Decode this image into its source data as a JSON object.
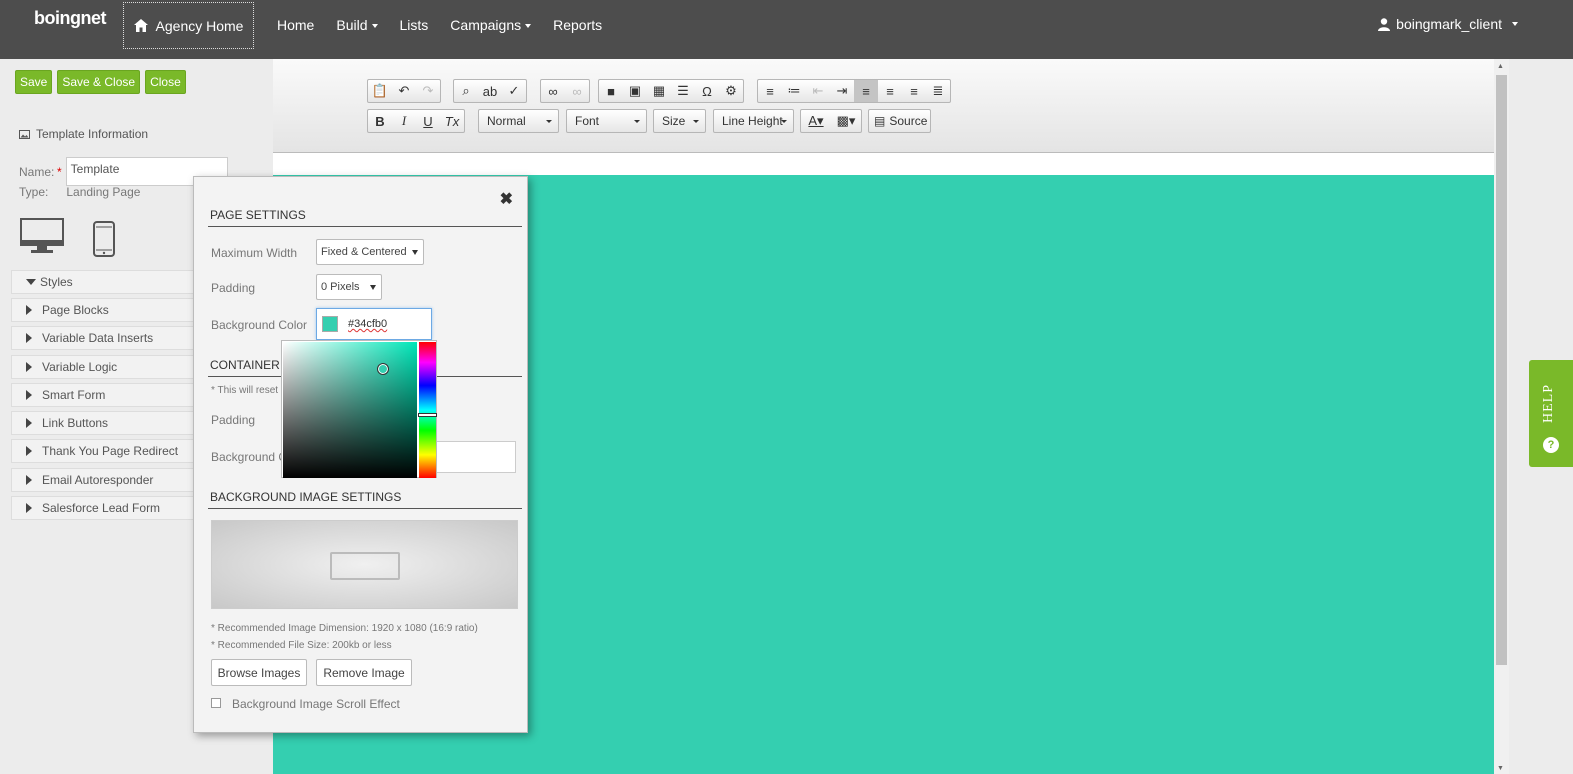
{
  "nav": {
    "logo": "boingnet",
    "agency_home": "Agency Home",
    "links": [
      "Home",
      "Build",
      "Lists",
      "Campaigns",
      "Reports"
    ],
    "user": "boingmark_client"
  },
  "left": {
    "buttons": {
      "save": "Save",
      "save_close": "Save & Close",
      "close": "Close"
    },
    "template_info": "Template Information",
    "name_label": "Name:",
    "name_required": "*",
    "name_value": "Template",
    "type_label": "Type:",
    "type_value": "Landing Page",
    "accordion": [
      "Styles",
      "Page Blocks",
      "Variable Data Inserts",
      "Variable Logic",
      "Smart Form",
      "Link Buttons",
      "Thank You Page Redirect",
      "Email Autoresponder",
      "Salesforce Lead Form"
    ]
  },
  "toolbar": {
    "format": "Normal",
    "font": "Font",
    "size": "Size",
    "line_height": "Line Height",
    "source": "Source"
  },
  "dialog": {
    "page_settings": "PAGE SETTINGS",
    "max_width_label": "Maximum Width",
    "max_width_value": "Fixed & Centered",
    "padding_label": "Padding",
    "padding_value": "0 Pixels",
    "bg_color_label": "Background Color",
    "bg_color_value": "#34cfb0",
    "container_settings": "CONTAINER SE",
    "reset_note": "* This will reset",
    "container_padding_label": "Padding",
    "container_bg_label": "Background C",
    "bg_image_settings": "BACKGROUND IMAGE SETTINGS",
    "note_dimension": "* Recommended Image Dimension: 1920 x 1080 (16:9 ratio)",
    "note_size": "* Recommended File Size: 200kb or less",
    "browse": "Browse Images",
    "remove": "Remove Image",
    "scroll_effect": "Background Image Scroll Effect"
  },
  "canvas_color": "#34cfb0",
  "help": "HELP"
}
